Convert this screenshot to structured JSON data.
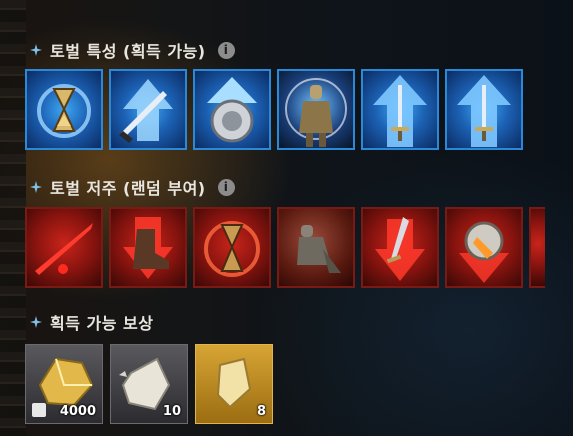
{
  "sections": {
    "traits": {
      "title": "토벌 특성 (획득 가능)",
      "info_icon": "i"
    },
    "curses": {
      "title": "토벌 저주 (랜덤 부여)",
      "info_icon": "i"
    },
    "rewards": {
      "title": "획득 가능 보상"
    }
  },
  "trait_icons": [
    "hourglass-cycle-icon",
    "sword-slash-up-icon",
    "shield-up-icon",
    "knight-aura-icon",
    "sword-up-icon",
    "sword-up-icon"
  ],
  "curse_icons": [
    "blood-slash-icon",
    "boot-down-icon",
    "hourglass-up-icon",
    "knight-kneel-icon",
    "sword-down-icon",
    "shield-break-icon",
    "partial-curse-icon"
  ],
  "rewards": [
    {
      "icon": "gold-ore-icon",
      "quantity": "4000"
    },
    {
      "icon": "silver-ore-icon",
      "quantity": "10"
    },
    {
      "icon": "gold-fragment-icon",
      "quantity": "8"
    }
  ],
  "colors": {
    "trait_border": "#2a8ad8",
    "curse_border": "#7a1a14",
    "title_text": "#e9e6df"
  }
}
